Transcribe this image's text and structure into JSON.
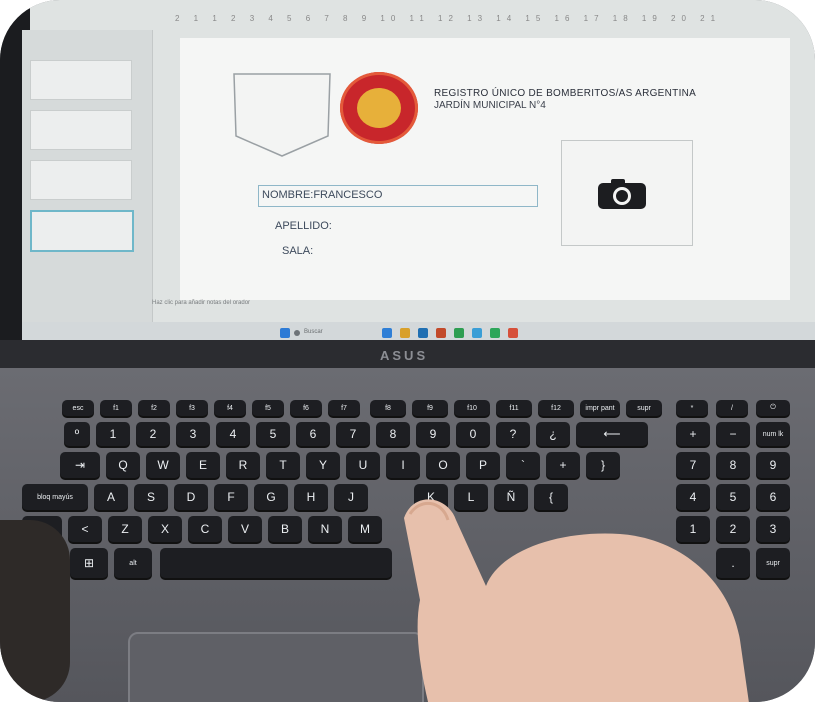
{
  "screen": {
    "ruler_text": "2 1 1 2 3 4 5 6 7 8 9 10 11 12 13 14 15 16 17 18 19 20 21",
    "header": {
      "line1": "REGISTRO ÚNICO DE BOMBERITOS/AS ARGENTINA",
      "line2": "JARDÍN MUNICIPAL N°4"
    },
    "form": {
      "nombre": "NOMBRE:FRANCESCO",
      "apellido": "APELLIDO:",
      "sala": "SALA:"
    },
    "notes_placeholder": "Haz clic para añadir notas del orador",
    "taskbar": {
      "search_placeholder": "Buscar"
    },
    "icons": [
      "document-icon",
      "camera-icon",
      "windows-icon",
      "search-icon"
    ]
  },
  "laptop": {
    "brand": "ASUS"
  },
  "keyboard": {
    "row0": [
      "esc",
      "f1",
      "f2",
      "f3",
      "f4",
      "f5",
      "f6",
      "f7",
      "f8",
      "f9",
      "f10",
      "f11",
      "f12",
      "impr pant",
      "supr",
      "*",
      "/",
      "⏻"
    ],
    "row1": [
      "º",
      "1",
      "2",
      "3",
      "4",
      "5",
      "6",
      "7",
      "8",
      "9",
      "0",
      "?",
      "¿",
      "⟵",
      "+",
      "−",
      "num lk"
    ],
    "row2": [
      "⇥",
      "Q",
      "W",
      "E",
      "R",
      "T",
      "Y",
      "U",
      "I",
      "O",
      "P",
      "`",
      "+",
      "}",
      "7",
      "8",
      "9"
    ],
    "row3": [
      "bloq mayús",
      "A",
      "S",
      "D",
      "F",
      "G",
      "H",
      "J",
      "K",
      "L",
      "Ñ",
      "{",
      "4",
      "5",
      "6"
    ],
    "row4": [
      "⇧",
      "<",
      "Z",
      "X",
      "C",
      "V",
      "B",
      "N",
      "M",
      "1",
      "2",
      "3"
    ],
    "row5": [
      "fn",
      "⊞",
      "alt",
      "",
      ".",
      "supr"
    ]
  },
  "colors": {
    "emblem": "#c8262b",
    "deck": "#5f6066",
    "key": "#1d1e22"
  }
}
